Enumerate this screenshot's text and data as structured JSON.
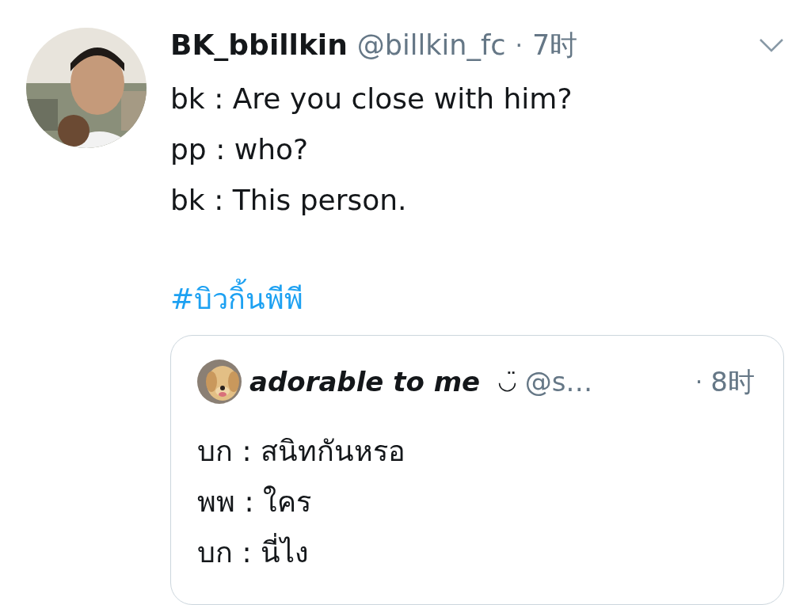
{
  "tweet": {
    "name": "BK_bbillkin",
    "handle": "@billkin_fc",
    "separator": "·",
    "time": "7时",
    "lines": [
      "bk : Are you close with him?",
      "pp : who?",
      "bk : This person."
    ],
    "hashtag": "#บิวกิ้นพีพี",
    "quote": {
      "name": "adorable to me",
      "emoji": "◡̈",
      "handle": "@s…",
      "separator": "·",
      "time": "8时",
      "lines": [
        "บก : สนิทกันหรอ",
        "พพ : ใคร",
        "บก : นี่ไง"
      ]
    }
  }
}
